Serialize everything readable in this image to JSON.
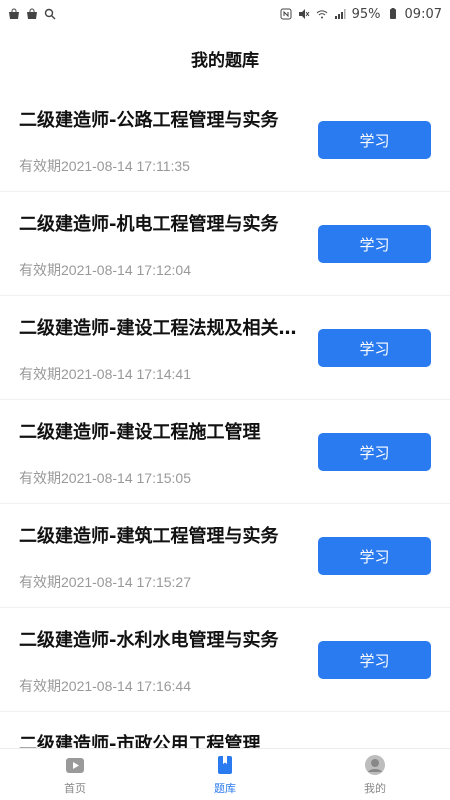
{
  "status_bar": {
    "battery": "95%",
    "time": "09:07"
  },
  "header": {
    "title": "我的题库"
  },
  "items": [
    {
      "title": "二级建造师-公路工程管理与实务",
      "expiry": "有效期2021-08-14 17:11:35",
      "button": "学习"
    },
    {
      "title": "二级建造师-机电工程管理与实务",
      "expiry": "有效期2021-08-14 17:12:04",
      "button": "学习"
    },
    {
      "title": "二级建造师-建设工程法规及相关知识",
      "expiry": "有效期2021-08-14 17:14:41",
      "button": "学习"
    },
    {
      "title": "二级建造师-建设工程施工管理",
      "expiry": "有效期2021-08-14 17:15:05",
      "button": "学习"
    },
    {
      "title": "二级建造师-建筑工程管理与实务",
      "expiry": "有效期2021-08-14 17:15:27",
      "button": "学习"
    },
    {
      "title": "二级建造师-水利水电管理与实务",
      "expiry": "有效期2021-08-14 17:16:44",
      "button": "学习"
    },
    {
      "title": "二级建造师-市政公用工程管理",
      "expiry": "",
      "button": ""
    }
  ],
  "bottom_nav": {
    "home": "首页",
    "question_bank": "题库",
    "mine": "我的",
    "active_color": "#2a7af0",
    "inactive_color": "#888888"
  },
  "accent_color": "#2a7af0"
}
